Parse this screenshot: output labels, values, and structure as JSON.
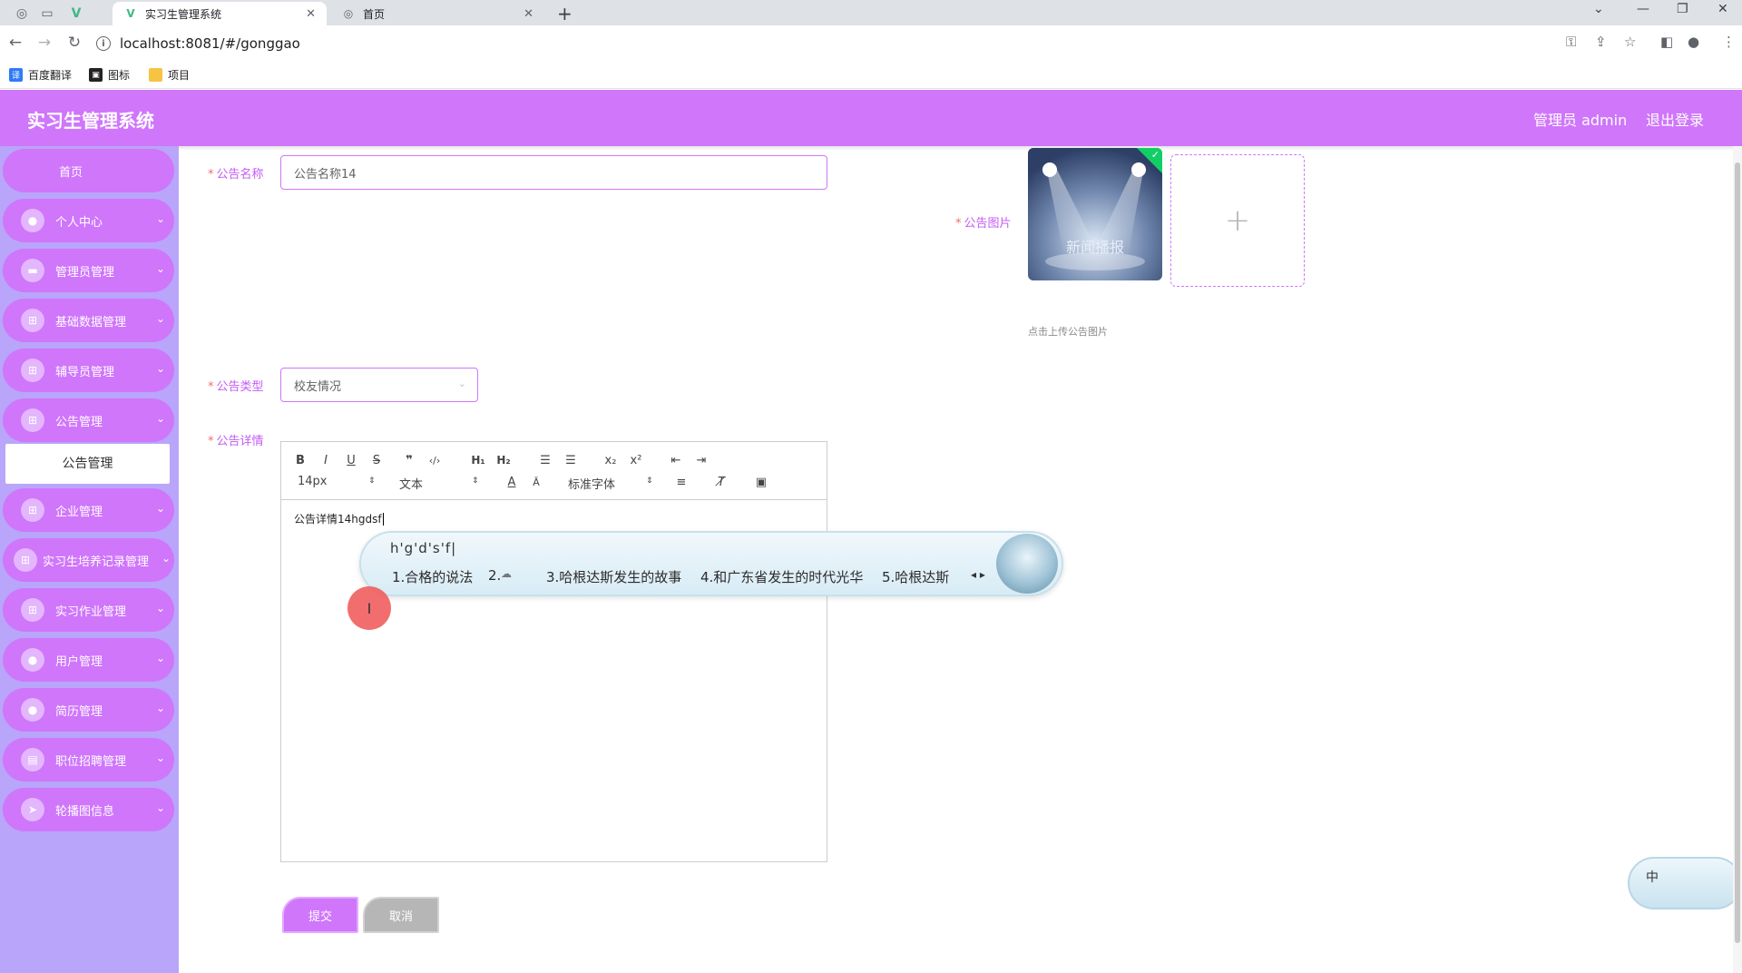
{
  "browser": {
    "tabs": [
      {
        "title": "实习生管理系统",
        "active": true,
        "icon": "vue-logo-icon"
      },
      {
        "title": "首页",
        "active": false,
        "icon": "globe-icon"
      }
    ],
    "new_tab": "+",
    "url": "localhost:8081/#/gonggao",
    "bookmarks": [
      {
        "label": "百度翻译",
        "icon": "baidu-translate-icon"
      },
      {
        "label": "图标",
        "icon": "image-bookmark-icon"
      },
      {
        "label": "项目",
        "icon": "folder-icon"
      }
    ]
  },
  "header": {
    "title": "实习生管理系统",
    "user": "管理员 admin",
    "logout": "退出登录",
    "color": "#cf76fb"
  },
  "sidebar": {
    "items": [
      {
        "label": "首页",
        "icon": ""
      },
      {
        "label": "个人中心",
        "icon": "user-icon"
      },
      {
        "label": "管理员管理",
        "icon": "chat-icon"
      },
      {
        "label": "基础数据管理",
        "icon": "grid-icon"
      },
      {
        "label": "辅导员管理",
        "icon": "grid-icon"
      },
      {
        "label": "公告管理",
        "icon": "grid-icon"
      },
      {
        "label": "企业管理",
        "icon": "grid-icon"
      },
      {
        "label": "实习生培养记录管理",
        "icon": "grid-icon"
      },
      {
        "label": "实习作业管理",
        "icon": "grid-icon"
      },
      {
        "label": "用户管理",
        "icon": "user-icon"
      },
      {
        "label": "简历管理",
        "icon": "user-icon"
      },
      {
        "label": "职位招聘管理",
        "icon": "briefcase-icon"
      },
      {
        "label": "轮播图信息",
        "icon": "send-icon"
      }
    ],
    "submenu": {
      "label": "公告管理"
    },
    "background": "#b9a5fa"
  },
  "form": {
    "name_label": "公告名称",
    "name_value": "公告名称14",
    "image_label": "公告图片",
    "image_caption": "新闻播报",
    "image_hint": "点击上传公告图片",
    "upload_plus": "+",
    "type_label": "公告类型",
    "type_value": "校友情况",
    "detail_label": "公告详情",
    "required_mark": "*",
    "submit": "提交",
    "cancel": "取消"
  },
  "editor": {
    "font_size": "14px",
    "block_type": "文本",
    "font_family": "标准字体",
    "content": "公告详情14hgdsf"
  },
  "ime": {
    "composition": "h'g'd's'f|",
    "candidates": [
      "1.合格的说法",
      "2.",
      "3.哈根达斯发生的故事",
      "4.和广东省发生的时代光华",
      "5.哈根达斯"
    ],
    "status_label": "中"
  }
}
